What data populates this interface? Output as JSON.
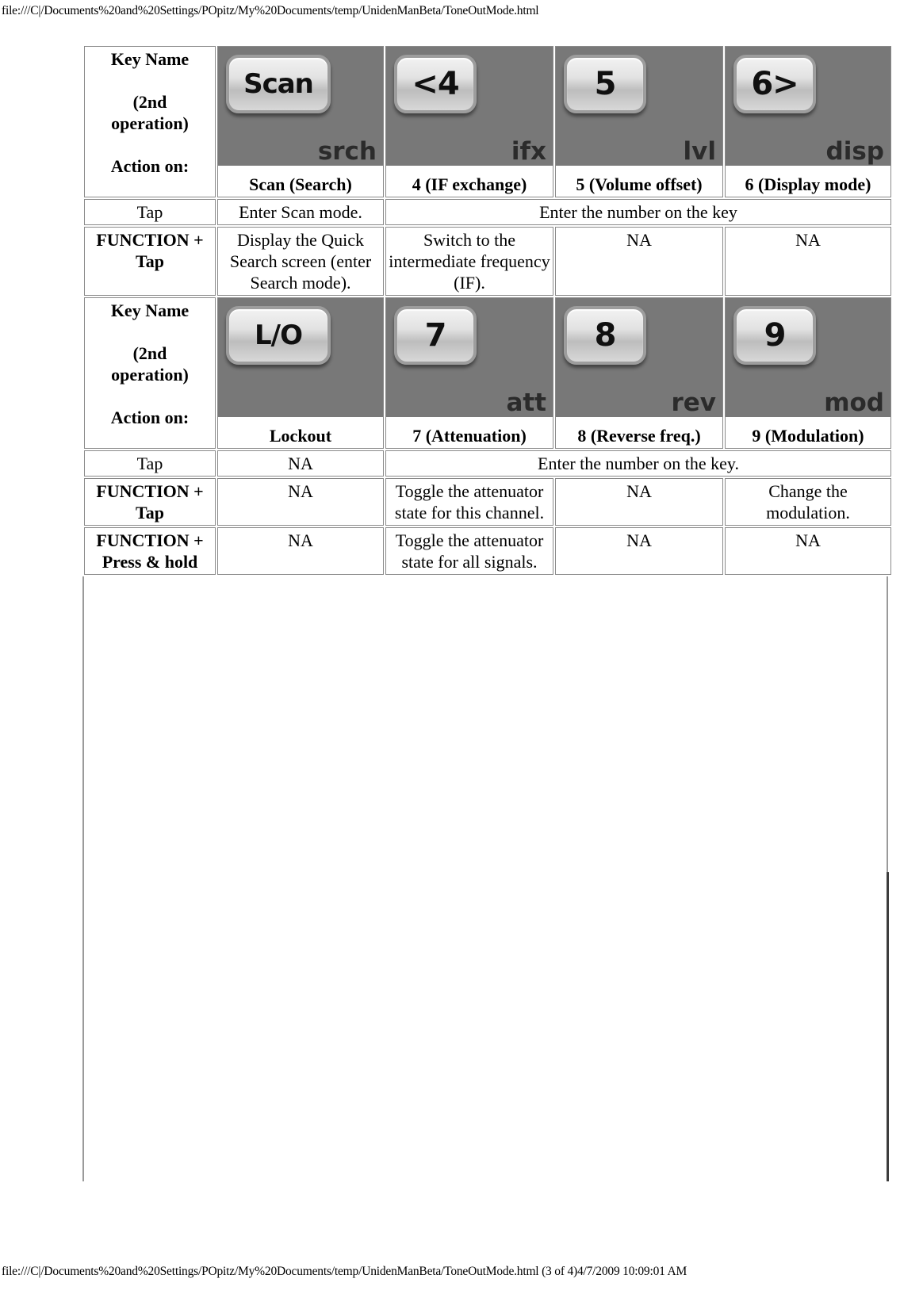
{
  "page": {
    "header_url": "file:///C|/Documents%20and%20Settings/POpitz/My%20Documents/temp/UnidenManBeta/ToneOutMode.html",
    "footer_url": "file:///C|/Documents%20and%20Settings/POpitz/My%20Documents/temp/UnidenManBeta/ToneOutMode.html (3 of 4)4/7/2009 10:09:01 AM"
  },
  "colors": {
    "header_bg": "#d3e5ea",
    "key_bg": "#787878",
    "border": "#8a8a8a"
  },
  "row_header": {
    "line1": "Key Name",
    "line2": "(2nd",
    "line3": "operation)",
    "line4": "Action on:"
  },
  "table1": {
    "keys": [
      {
        "cap_text": "Scan",
        "cap_style": "small",
        "sub_label": "srch",
        "caption": "Scan (Search)"
      },
      {
        "cap_text": "<4",
        "cap_style": "normal",
        "sub_label": "ifx",
        "caption": "4 (IF exchange)"
      },
      {
        "cap_text": "5",
        "cap_style": "normal",
        "sub_label": "lvl",
        "caption": "5 (Volume offset)"
      },
      {
        "cap_text": "6>",
        "cap_style": "normal",
        "sub_label": "disp",
        "caption": "6 (Display mode)"
      }
    ],
    "rows": [
      {
        "action": "Tap",
        "action_align": "left",
        "action_bold": false,
        "cells": [
          {
            "text": "Enter Scan mode.",
            "span": 1
          },
          {
            "text": "Enter the number on the key",
            "span": 3
          }
        ]
      },
      {
        "action": "FUNCTION + Tap",
        "action_align": "center",
        "action_bold": true,
        "cells": [
          {
            "text": "Display the Quick Search screen (enter Search mode).",
            "span": 1
          },
          {
            "text": "Switch to the intermediate frequency (IF).",
            "span": 1
          },
          {
            "text": "NA",
            "span": 1
          },
          {
            "text": "NA",
            "span": 1
          }
        ]
      }
    ]
  },
  "table2": {
    "keys": [
      {
        "cap_text": "L/O",
        "cap_style": "small",
        "sub_label": "",
        "caption": "Lockout"
      },
      {
        "cap_text": "7",
        "cap_style": "normal",
        "sub_label": "att",
        "caption": "7 (Attenuation)"
      },
      {
        "cap_text": "8",
        "cap_style": "normal",
        "sub_label": "rev",
        "caption": "8 (Reverse freq.)"
      },
      {
        "cap_text": "9",
        "cap_style": "normal",
        "sub_label": "mod",
        "caption": "9 (Modulation)"
      }
    ],
    "rows": [
      {
        "action": "Tap",
        "action_align": "center",
        "action_bold": false,
        "cells": [
          {
            "text": "NA",
            "span": 1
          },
          {
            "text": "Enter the number on the key.",
            "span": 3
          }
        ]
      },
      {
        "action": "FUNCTION + Tap",
        "action_align": "center",
        "action_bold": true,
        "cells": [
          {
            "text": "NA",
            "span": 1
          },
          {
            "text": "Toggle the attenuator state for this channel.",
            "span": 1
          },
          {
            "text": "NA",
            "span": 1
          },
          {
            "text": "Change the modulation.",
            "span": 1
          }
        ]
      },
      {
        "action": "FUNCTION + Press & hold",
        "action_align": "center",
        "action_bold": true,
        "cells": [
          {
            "text": "NA",
            "span": 1
          },
          {
            "text": "Toggle the attenuator state for all signals.",
            "span": 1
          },
          {
            "text": "NA",
            "span": 1
          },
          {
            "text": "NA",
            "span": 1
          }
        ]
      }
    ]
  }
}
